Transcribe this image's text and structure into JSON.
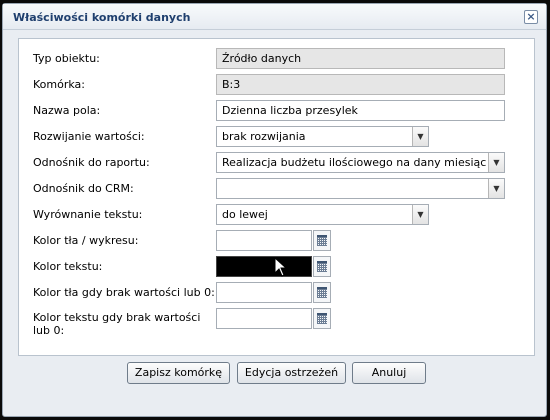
{
  "dialog": {
    "title": "Właściwości komórki danych",
    "close_label": "×"
  },
  "form": {
    "object_type": {
      "label": "Typ obiektu:",
      "value": "Źródło danych"
    },
    "cell": {
      "label": "Komórka:",
      "value": "B:3"
    },
    "field_name": {
      "label": "Nazwa pola:",
      "value": "Dzienna liczba przesylek"
    },
    "value_rollout": {
      "label": "Rozwijanie wartości:",
      "value": "brak rozwijania"
    },
    "report_link": {
      "label": "Odnośnik do raportu:",
      "value": "Realizacja budżetu ilościowego na dany miesiąc"
    },
    "crm_link": {
      "label": "Odnośnik do CRM:",
      "value": ""
    },
    "text_align": {
      "label": "Wyrównanie tekstu:",
      "value": "do lewej"
    },
    "bg_color": {
      "label": "Kolor tła / wykresu:",
      "value": ""
    },
    "text_color": {
      "label": "Kolor tekstu:",
      "value": "#000000"
    },
    "bg_color_empty": {
      "label": "Kolor tła gdy brak wartości lub 0:",
      "value": ""
    },
    "text_color_empty": {
      "label_line1": "Kolor tekstu gdy brak wartości",
      "label_line2": "lub 0:",
      "value": ""
    }
  },
  "buttons": {
    "save": "Zapisz komórkę",
    "warnings": "Edycja ostrzeżeń",
    "cancel": "Anuluj"
  },
  "icons": {
    "close": "close-icon",
    "dropdown": "chevron-down-icon",
    "color_picker": "color-picker-icon",
    "cursor": "mouse-pointer-icon"
  },
  "colors": {
    "title_text": "#1f3f6e",
    "dialog_bg": "#e9edf2",
    "text_color_value": "#000000"
  }
}
